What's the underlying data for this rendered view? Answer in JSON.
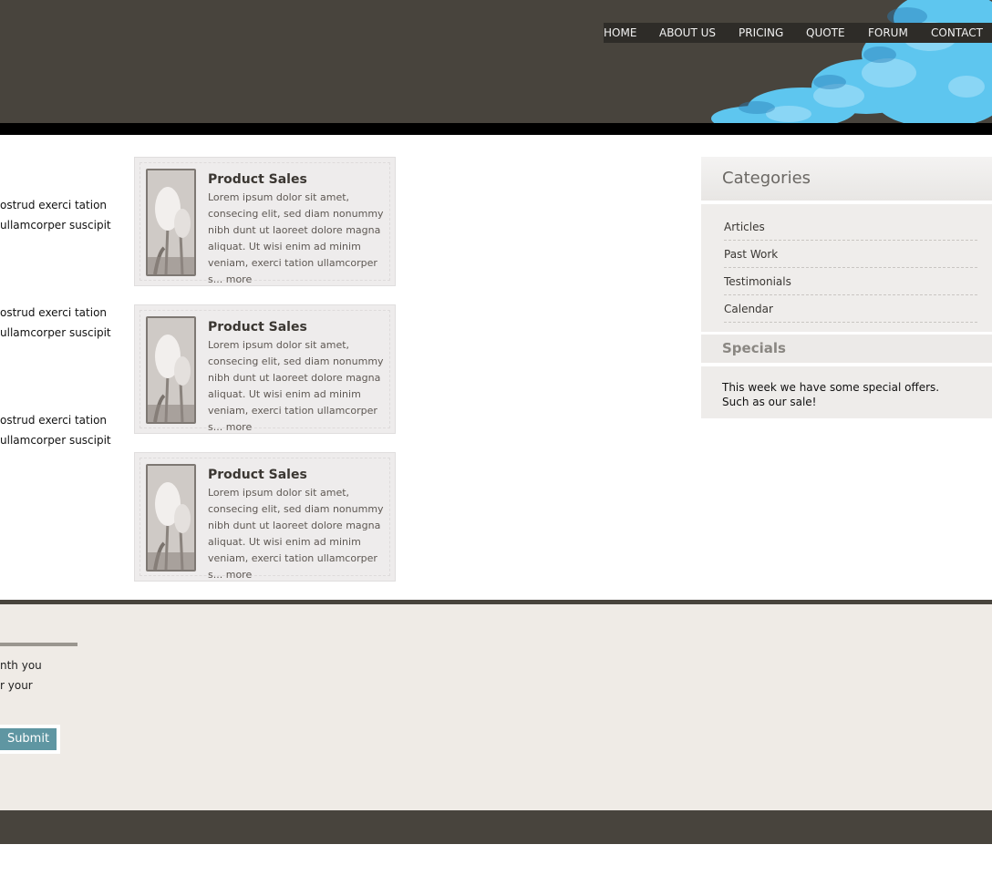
{
  "nav": {
    "items": [
      "HOME",
      "ABOUT US",
      "PRICING",
      "QUOTE",
      "FORUM",
      "CONTACT"
    ]
  },
  "left_text": {
    "rows": [
      "ostrud exerci tation",
      "ullamcorper suscipit",
      "ostrud exerci tation",
      "ullamcorper suscipit",
      "ostrud exerci tation",
      "ullamcorper suscipit"
    ]
  },
  "products": [
    {
      "title": "Product Sales",
      "desc": "Lorem ipsum dolor sit amet, consecing elit, sed diam nonummy nibh dunt ut laoreet dolore magna aliquat. Ut wisi enim ad minim veniam, exerci tation ullamcorper s...",
      "more": "more"
    },
    {
      "title": "Product Sales",
      "desc": "Lorem ipsum dolor sit amet, consecing elit, sed diam nonummy nibh dunt ut laoreet dolore magna aliquat. Ut wisi enim ad minim veniam, exerci tation ullamcorper s...",
      "more": "more"
    },
    {
      "title": "Product Sales",
      "desc": "Lorem ipsum dolor sit amet, consecing elit, sed diam nonummy nibh dunt ut laoreet dolore magna aliquat. Ut wisi enim ad minim veniam, exerci tation ullamcorper s...",
      "more": "more"
    }
  ],
  "sidebar": {
    "categories_title": "Categories",
    "categories": [
      "Articles",
      "Past Work",
      "Testimonials",
      "Calendar"
    ],
    "specials_title": "Specials",
    "specials_lines": [
      "This week we have some special offers.",
      "Such as our sale!"
    ]
  },
  "footer": {
    "text_lines": [
      "nth you",
      "r your"
    ],
    "submit_label": "Submit"
  },
  "colors": {
    "header": "#48443d",
    "nav_bg": "#2e2c28",
    "accent_button": "#5f96a2",
    "footer_bg": "#efebe6"
  }
}
